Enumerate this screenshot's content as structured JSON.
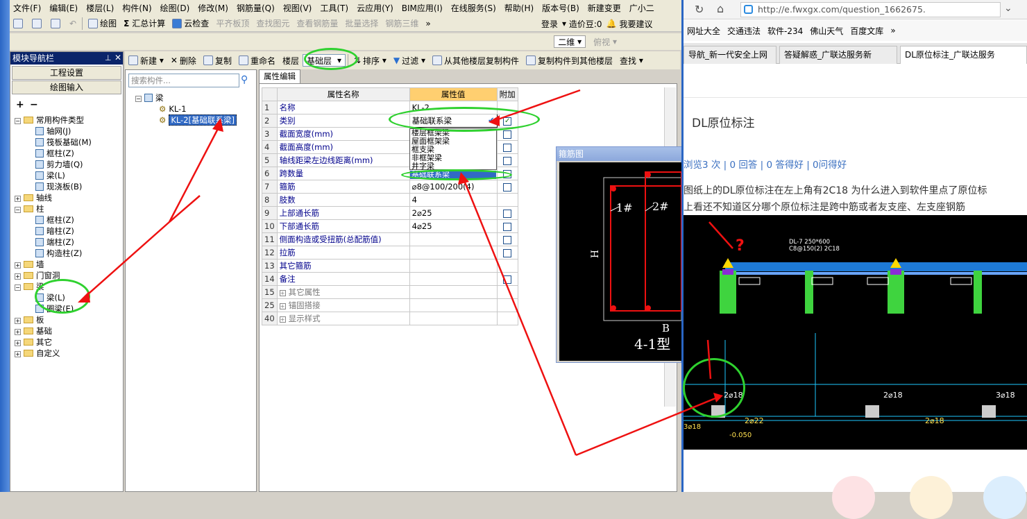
{
  "menubar": {
    "items": [
      "文件(F)",
      "编辑(E)",
      "楼层(L)",
      "构件(N)",
      "绘图(D)",
      "修改(M)",
      "钢筋量(Q)",
      "视图(V)",
      "工具(T)",
      "云应用(Y)",
      "BIM应用(I)",
      "在线服务(S)",
      "帮助(H)",
      "版本号(B)",
      "新建变更",
      "广小二"
    ]
  },
  "toolbar1": {
    "draw": "绘图",
    "sum": "汇总计算",
    "cloud_check": "云检查",
    "flat_top": "平齐板顶",
    "find_elem": "查找图元",
    "view_rebar": "查看钢筋量",
    "batch_select": "批量选择",
    "rebar_3d": "钢筋三维"
  },
  "toolbar2": {
    "login": "登录",
    "cost": "造价豆:0",
    "suggest": "我要建议",
    "view2d": "二维",
    "view_mode": "俯视"
  },
  "navpanel": {
    "title": "模块导航栏",
    "btn_project": "工程设置",
    "btn_draw": "绘图输入",
    "tree": [
      {
        "label": "常用构件类型",
        "level": 0,
        "folder": true,
        "open": true
      },
      {
        "label": "轴网(J)",
        "level": 1
      },
      {
        "label": "筏板基础(M)",
        "level": 1
      },
      {
        "label": "框柱(Z)",
        "level": 1
      },
      {
        "label": "剪力墙(Q)",
        "level": 1
      },
      {
        "label": "梁(L)",
        "level": 1
      },
      {
        "label": "现浇板(B)",
        "level": 1
      },
      {
        "label": "轴线",
        "level": 0,
        "folder": true,
        "open": false
      },
      {
        "label": "柱",
        "level": 0,
        "folder": true,
        "open": true
      },
      {
        "label": "框柱(Z)",
        "level": 1
      },
      {
        "label": "暗柱(Z)",
        "level": 1
      },
      {
        "label": "端柱(Z)",
        "level": 1
      },
      {
        "label": "构造柱(Z)",
        "level": 1
      },
      {
        "label": "墙",
        "level": 0,
        "folder": true,
        "open": false
      },
      {
        "label": "门窗洞",
        "level": 0,
        "folder": true,
        "open": false
      },
      {
        "label": "梁",
        "level": 0,
        "folder": true,
        "open": true
      },
      {
        "label": "梁(L)",
        "level": 1
      },
      {
        "label": "圈梁(E)",
        "level": 1
      },
      {
        "label": "板",
        "level": 0,
        "folder": true,
        "open": false
      },
      {
        "label": "基础",
        "level": 0,
        "folder": true,
        "open": false
      },
      {
        "label": "其它",
        "level": 0,
        "folder": true,
        "open": false
      },
      {
        "label": "自定义",
        "level": 0,
        "folder": true,
        "open": false
      }
    ]
  },
  "midtools": {
    "new": "新建",
    "delete": "删除",
    "copy": "复制",
    "rename": "重命名",
    "floor_label": "楼层",
    "floor_value": "基础层",
    "sort": "排序",
    "filter": "过滤",
    "copy_from": "从其他楼层复制构件",
    "copy_to": "复制构件到其他楼层",
    "find": "查找"
  },
  "comppanel": {
    "search_placeholder": "搜索构件...",
    "root": "梁",
    "items": [
      "KL-1",
      "KL-2[基础联系梁]"
    ]
  },
  "props": {
    "tab": "属性编辑",
    "headers": {
      "name": "属性名称",
      "value": "属性值",
      "add": "附加"
    },
    "rows": [
      {
        "n": "1",
        "name": "名称",
        "value": "KL-2",
        "add": ""
      },
      {
        "n": "2",
        "name": "类别",
        "value": "基础联系梁",
        "add": "checked"
      },
      {
        "n": "3",
        "name": "截面宽度(mm)",
        "value": "",
        "add": "box"
      },
      {
        "n": "4",
        "name": "截面高度(mm)",
        "value": "",
        "add": "box"
      },
      {
        "n": "5",
        "name": "轴线距梁左边线距离(mm)",
        "value": "",
        "add": "box"
      },
      {
        "n": "6",
        "name": "跨数量",
        "value": "",
        "add": "box"
      },
      {
        "n": "7",
        "name": "箍筋",
        "value": "⌀8@100/200(4)",
        "add": "box"
      },
      {
        "n": "8",
        "name": "肢数",
        "value": "4",
        "add": ""
      },
      {
        "n": "9",
        "name": "上部通长筋",
        "value": "2⌀25",
        "add": "box"
      },
      {
        "n": "10",
        "name": "下部通长筋",
        "value": "4⌀25",
        "add": "box"
      },
      {
        "n": "11",
        "name": "侧面构造或受扭筋(总配筋值)",
        "value": "",
        "add": "box"
      },
      {
        "n": "12",
        "name": "拉筋",
        "value": "",
        "add": "box"
      },
      {
        "n": "13",
        "name": "其它箍筋",
        "value": "",
        "add": ""
      },
      {
        "n": "14",
        "name": "备注",
        "value": "",
        "add": "box"
      },
      {
        "n": "15",
        "name": "其它属性",
        "value": "",
        "add": "",
        "group": true
      },
      {
        "n": "25",
        "name": "锚固搭接",
        "value": "",
        "add": "",
        "group": true
      },
      {
        "n": "40",
        "name": "显示样式",
        "value": "",
        "add": "",
        "group": true
      }
    ],
    "dropdown": [
      "楼层框架梁",
      "屋面框架梁",
      "框支梁",
      "非框架梁",
      "井字梁",
      "基础联系梁"
    ]
  },
  "rebar": {
    "title": "箍筋图",
    "label1": "1#",
    "label2": "2#",
    "h": "H",
    "b": "B",
    "type": "4-1型"
  },
  "browser": {
    "url": "http://e.fwxgx.com/question_1662675.",
    "bookmarks": [
      "网址大全",
      "交通违法",
      "软件-234",
      "佛山天气",
      "百度文库"
    ],
    "tabs": [
      "导航_新一代安全上网",
      "答疑解惑_广联达服务新",
      "DL原位标注_广联达服务"
    ],
    "question_title": "DL原位标注",
    "stats": "浏览3 次 | 0 回答 | 0 答得好 | 0问得好",
    "text1": "图纸上的DL原位标注在左上角有2C18   为什么进入到软件里点了原位标",
    "text2": "上看还不知道区分哪个原位标注是跨中筋或者友支座、左支座钢筋",
    "cad_labels": [
      "DL-7 250*600",
      "C8@150(2) 2C18",
      "2⌀18",
      "2⌀18",
      "3⌀18",
      "2⌀18",
      "2⌀22",
      "3⌀18",
      "-0.050"
    ]
  },
  "colors": {
    "accent": "#0a246a",
    "highlight": "#316ac5",
    "annotation_green": "#2fd12f",
    "annotation_red": "#ee1111"
  }
}
